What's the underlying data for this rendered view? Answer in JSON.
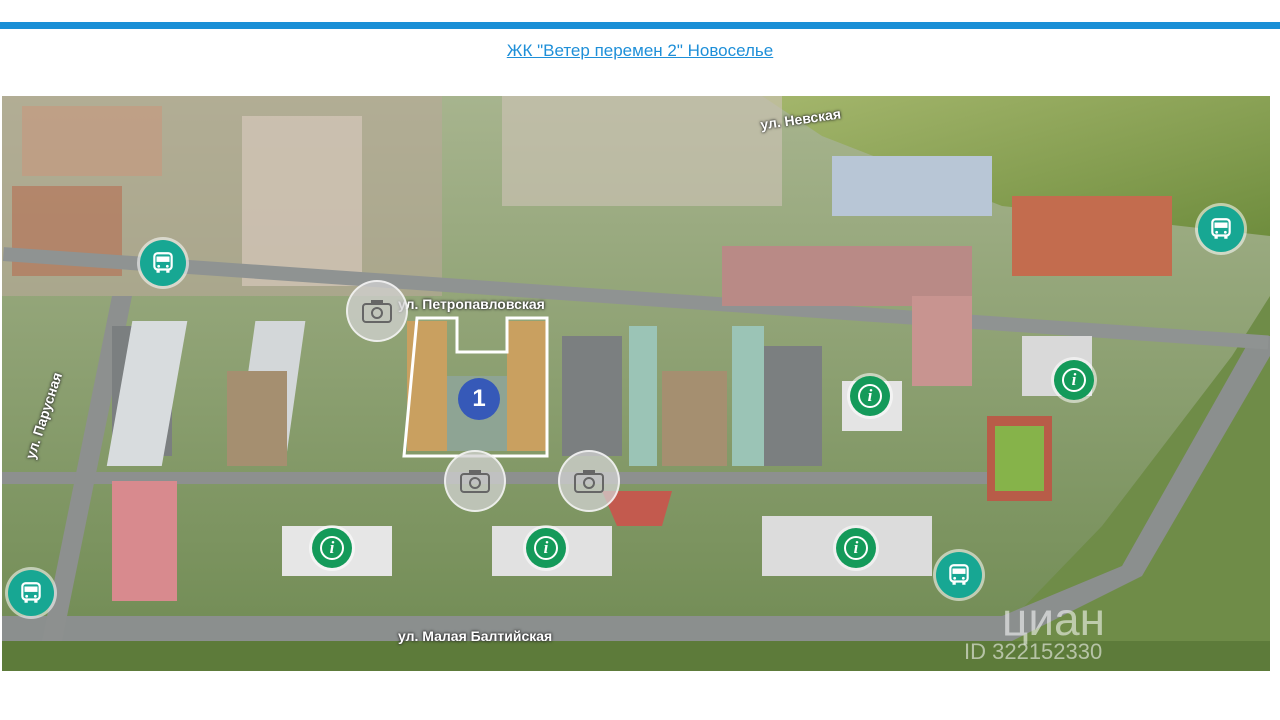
{
  "page": {
    "title_link": "ЖК \"Ветер перемен 2\" Новоселье",
    "accent_color": "#1a8fd6"
  },
  "map": {
    "streets": {
      "nevskaya": "ул. Невская",
      "petropavlovskaya": "ул. Петропавловская",
      "parusnaya": "ул. Парусная",
      "malaya_baltiyskaya": "ул. Малая Балтийская"
    },
    "building_number": "1",
    "markers": {
      "bus_icon": "bus-icon",
      "info_icon": "info-icon",
      "camera_icon": "camera-icon",
      "info_glyph": "i",
      "bus_color": "#17a793",
      "info_color": "#149a5a",
      "building_color": "#3659b8"
    },
    "watermark": {
      "brand": "циан",
      "id": "ID 322152330"
    }
  }
}
